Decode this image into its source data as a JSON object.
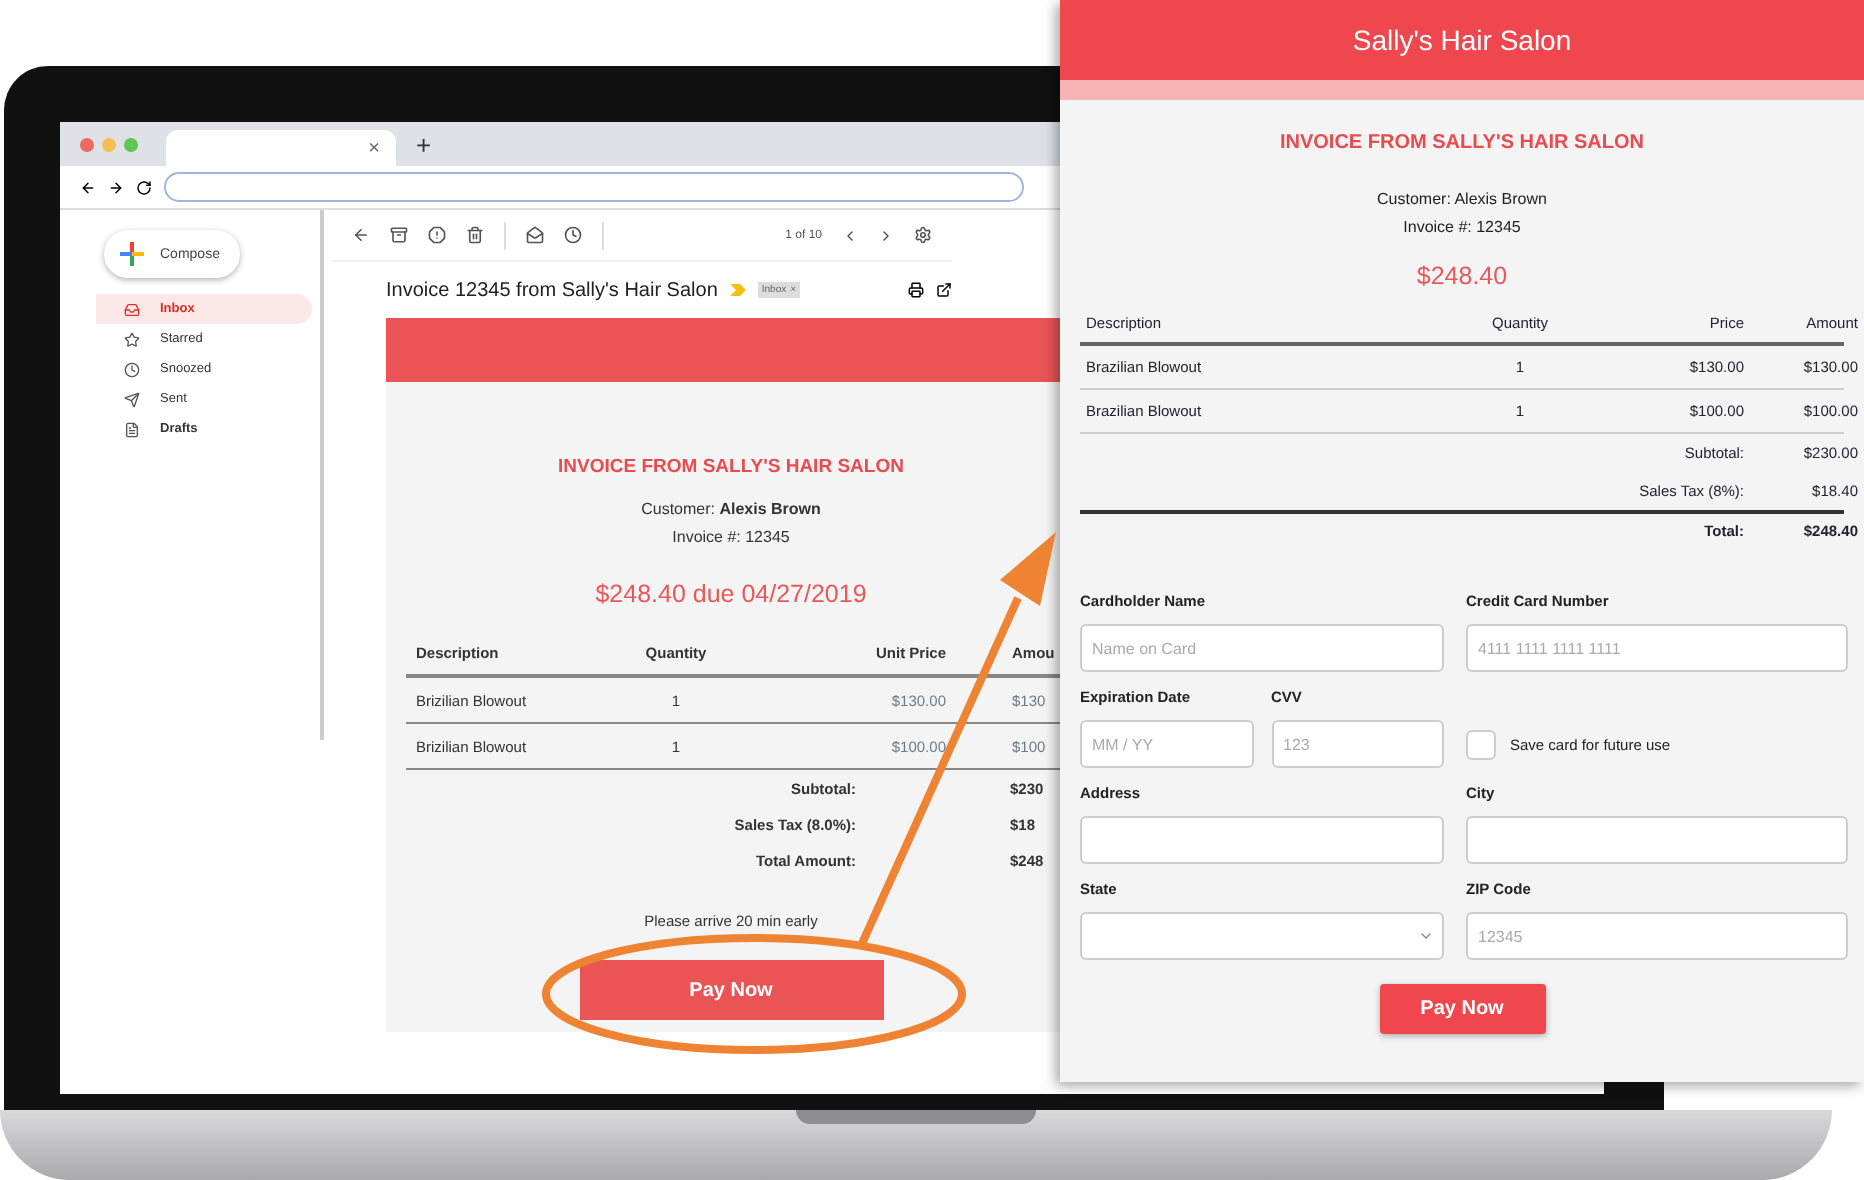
{
  "browser": {
    "tab_close": "×",
    "new_tab": "+"
  },
  "mail": {
    "compose": "Compose",
    "folders": [
      {
        "label": "Inbox",
        "selected": true,
        "unread": true
      },
      {
        "label": "Starred",
        "selected": false,
        "unread": false
      },
      {
        "label": "Snoozed",
        "selected": false,
        "unread": false
      },
      {
        "label": "Sent",
        "selected": false,
        "unread": false
      },
      {
        "label": "Drafts",
        "selected": false,
        "unread": true
      }
    ],
    "pager": "1 of 10",
    "subject": "Invoice 12345 from Sally's Hair Salon",
    "tag": {
      "label": "Inbox",
      "remove": "×"
    }
  },
  "email": {
    "title": "INVOICE FROM SALLY'S HAIR SALON",
    "customer": "Customer: **Alexis Brown**",
    "invoice_no": "Invoice #: 12345",
    "due": "$248.40 due 04/27/2019",
    "columns": [
      "Description",
      "Quantity",
      "Unit Price",
      "Amou"
    ],
    "rows": [
      [
        "Brizilian Blowout",
        "1",
        "$130.00",
        "$130"
      ],
      [
        "Brizilian Blowout",
        "1",
        "$100.00",
        "$100"
      ]
    ],
    "totals": [
      [
        "Subtotal:",
        "$230"
      ],
      [
        "Sales Tax (8.0%):",
        "$18"
      ],
      [
        "Total Amount:",
        "$248"
      ]
    ],
    "note": "Please arrive 20 min early",
    "button": "Pay Now"
  },
  "popup": {
    "header": "Sally's Hair Salon",
    "title": "INVOICE FROM SALLY'S HAIR SALON",
    "customer": "Customer: Alexis Brown",
    "invoice_no": "Invoice #: 12345",
    "amount": "$248.40",
    "columns": [
      "Description",
      "Quantity",
      "Price",
      "Amount"
    ],
    "rows": [
      [
        "Brazilian Blowout",
        "1",
        "$130.00",
        "$130.00"
      ],
      [
        "Brazilian Blowout",
        "1",
        "$100.00",
        "$100.00"
      ]
    ],
    "totals": [
      [
        "Subtotal:",
        "$230.00"
      ],
      [
        "Sales Tax (8%):",
        "$18.40"
      ],
      [
        "Total:",
        "$248.40"
      ]
    ],
    "form": [
      {
        "left": [
          {
            "kind": "text",
            "label": "Cardholder Name",
            "placeholder": "Name on Card"
          }
        ],
        "right": [
          {
            "kind": "text",
            "label": "Credit Card Number",
            "placeholder": "4111 1111 1111 1111"
          }
        ]
      },
      {
        "left": [
          {
            "kind": "text",
            "label": "Expiration Date",
            "placeholder": "MM / YY"
          },
          {
            "kind": "text",
            "label": "CVV",
            "placeholder": "123"
          }
        ],
        "right": [
          {
            "kind": "checkbox",
            "label": "Save card for future use",
            "checked": false
          }
        ]
      },
      {
        "left": [
          {
            "kind": "text",
            "label": "Address"
          }
        ],
        "right": [
          {
            "kind": "text",
            "label": "City"
          }
        ]
      },
      {
        "left": [
          {
            "kind": "select",
            "label": "State"
          }
        ],
        "right": [
          {
            "kind": "text",
            "label": "ZIP Code",
            "placeholder": "12345"
          }
        ]
      }
    ],
    "button": "Pay Now"
  }
}
